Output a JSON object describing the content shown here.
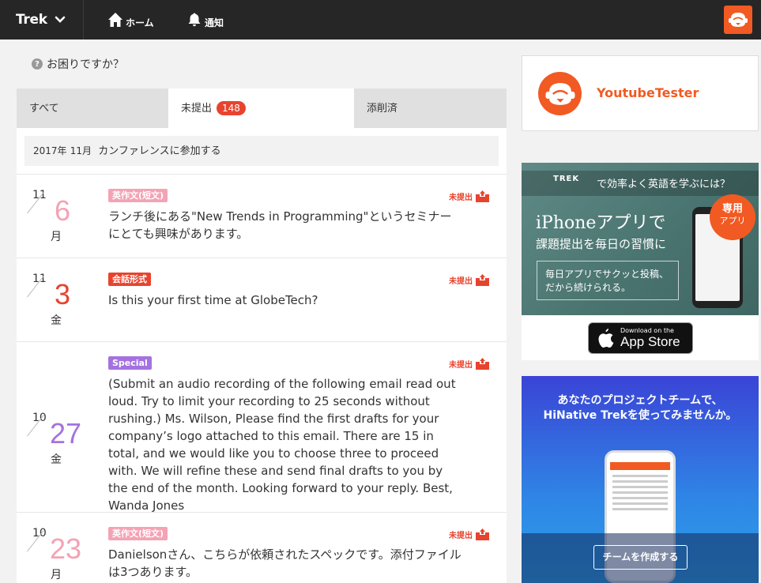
{
  "nav": {
    "brand": "Trek",
    "home_label": "ホーム",
    "notifications_label": "通知"
  },
  "help": {
    "label": "お困りですか？"
  },
  "tabs": {
    "all": "すべて",
    "pending": "未提出",
    "pending_count": "148",
    "reviewed": "添削済"
  },
  "group": {
    "year": "2017年",
    "month": "11月",
    "title": "カンファレンスに参加する"
  },
  "tasks": [
    {
      "month": "11",
      "day": "6",
      "weekday": "月",
      "day_color": "#f4a3b4",
      "tag": "英作文(短文)",
      "tag_color": "#f4a3b4",
      "status": "未提出",
      "text": "ランチ後にある\"New Trends in Programming\"というセミナーにとても興味があります。"
    },
    {
      "month": "11",
      "day": "3",
      "weekday": "金",
      "day_color": "#e8432e",
      "tag": "会話形式",
      "tag_color": "#e8432e",
      "status": "未提出",
      "text": "Is this your first time at GlobeTech?"
    },
    {
      "month": "10",
      "day": "27",
      "weekday": "金",
      "day_color": "#a472e0",
      "tag": "Special",
      "tag_color": "#a472e0",
      "status": "未提出",
      "text": "(Submit an audio recording of the following email read out loud. Try to limit your recording to 25 seconds without rushing.) Ms. Wilson, Please find the first drafts for your company’s logo attached to this email. There are 15 in total, and we would like you to choose three to proceed with. We will refine these and send final drafts to you by the end of the month. Looking forward to your reply. Best, Wanda Jones"
    },
    {
      "month": "10",
      "day": "23",
      "weekday": "月",
      "day_color": "#f4a3b4",
      "tag": "英作文(短文)",
      "tag_color": "#f4a3b4",
      "status": "未提出",
      "text": "Danielsonさん、こちらが依頼されたスペックです。添付ファイルは3つあります。"
    }
  ],
  "profile": {
    "name": "YoutubeTester"
  },
  "ad_app": {
    "logo": "TREK",
    "headline": "で効率よく英語を学ぶには？",
    "title": "iPhoneアプリで",
    "subtitle": "課題提出を毎日の習慣に",
    "box_text": "毎日アプリでサクッと投稿、だから続けられる。",
    "ribbon_main": "専用",
    "ribbon_sub": "アプリ",
    "store_line1": "Download on the",
    "store_line2": "App Store"
  },
  "ad_team": {
    "title_line1": "あなたのプロジェクトチームで、",
    "title_line2": "HiNative Trekを使ってみませんか。",
    "button": "チームを作成する"
  },
  "colors": {
    "accent": "#f15a22",
    "status_red": "#e8432e",
    "nav_bg": "#262626"
  }
}
